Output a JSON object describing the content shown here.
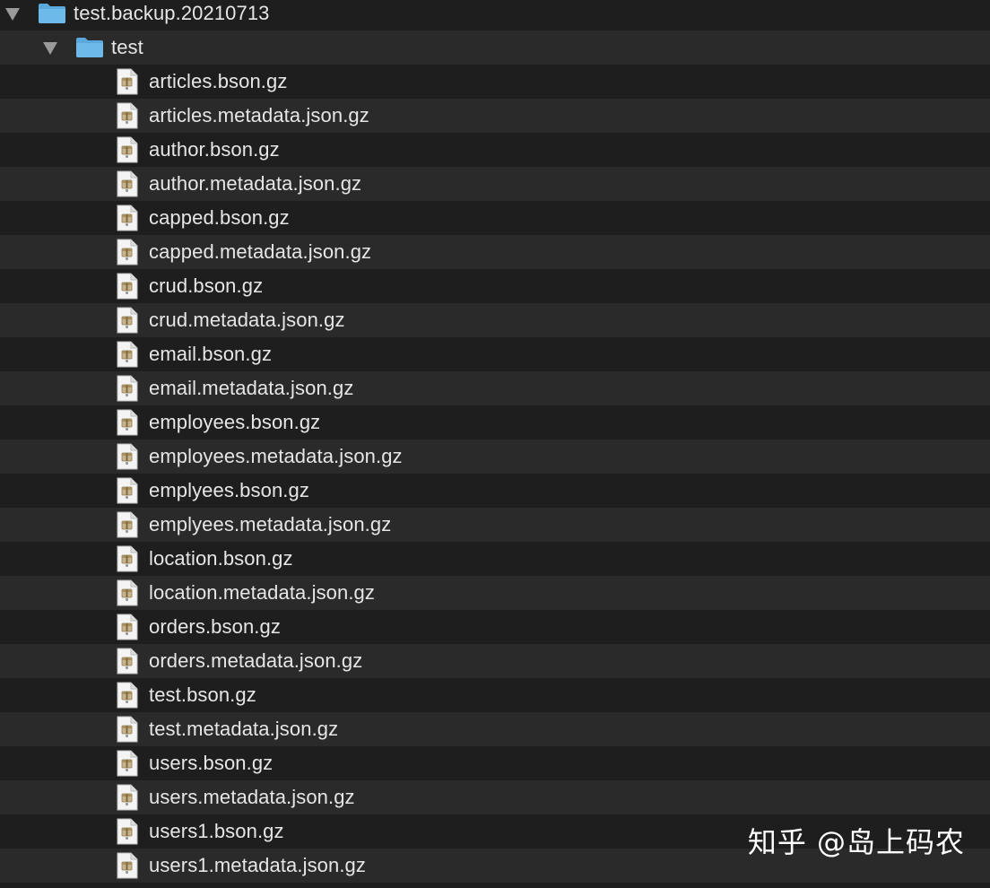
{
  "root_folder": {
    "name": "test.backup.20210713",
    "expanded": true,
    "icon": "folder-icon"
  },
  "sub_folder": {
    "name": "test",
    "expanded": true,
    "icon": "folder-icon"
  },
  "files": [
    "articles.bson.gz",
    "articles.metadata.json.gz",
    "author.bson.gz",
    "author.metadata.json.gz",
    "capped.bson.gz",
    "capped.metadata.json.gz",
    "crud.bson.gz",
    "crud.metadata.json.gz",
    "email.bson.gz",
    "email.metadata.json.gz",
    "employees.bson.gz",
    "employees.metadata.json.gz",
    "emplyees.bson.gz",
    "emplyees.metadata.json.gz",
    "location.bson.gz",
    "location.metadata.json.gz",
    "orders.bson.gz",
    "orders.metadata.json.gz",
    "test.bson.gz",
    "test.metadata.json.gz",
    "users.bson.gz",
    "users.metadata.json.gz",
    "users1.bson.gz",
    "users1.metadata.json.gz"
  ],
  "file_icon": "archive-file-icon",
  "watermark": "知乎 @岛上码农",
  "colors": {
    "background": "#1e1e1e",
    "row_alt": "#2a2a2a",
    "text": "#e6e6e6",
    "folder": "#5aa8dc"
  }
}
